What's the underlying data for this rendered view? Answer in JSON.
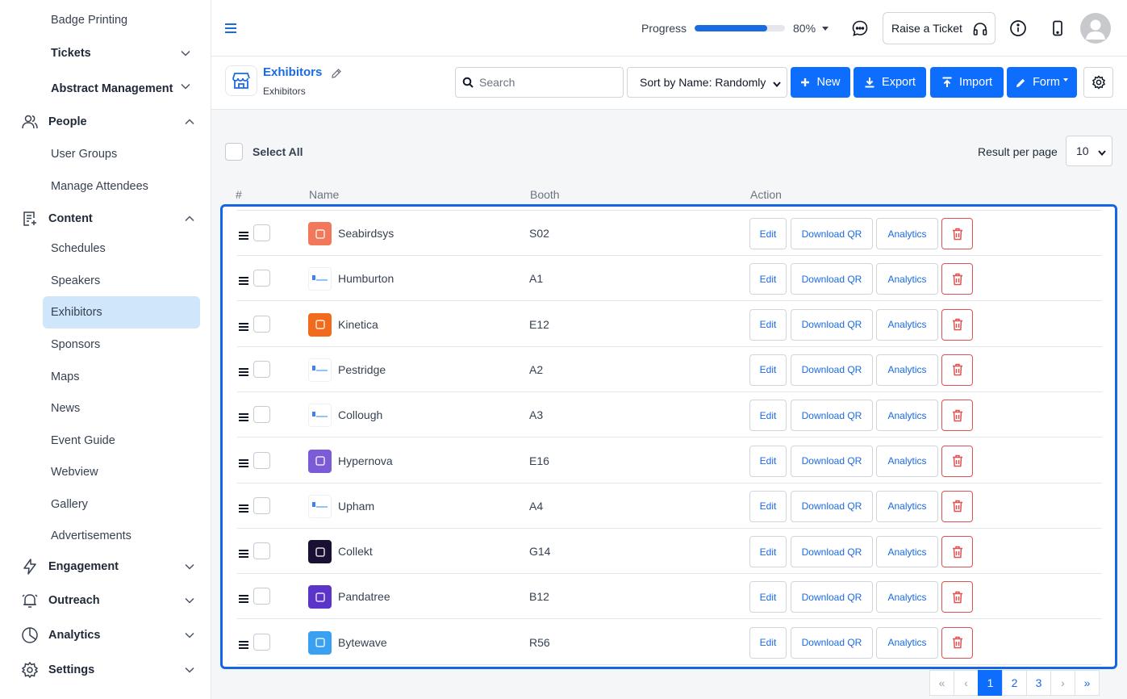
{
  "sidebar": {
    "badge_printing": "Badge Printing",
    "tickets": "Tickets",
    "abstract_management": "Abstract Management",
    "people": "People",
    "user_groups": "User Groups",
    "manage_attendees": "Manage Attendees",
    "content": "Content",
    "schedules": "Schedules",
    "speakers": "Speakers",
    "exhibitors": "Exhibitors",
    "sponsors": "Sponsors",
    "maps": "Maps",
    "news": "News",
    "event_guide": "Event Guide",
    "webview": "Webview",
    "gallery": "Gallery",
    "advertisements": "Advertisements",
    "engagement": "Engagement",
    "outreach": "Outreach",
    "analytics": "Analytics",
    "settings": "Settings",
    "active_item": "Exhibitors"
  },
  "topbar": {
    "progress_label": "Progress",
    "progress_value": 0.8,
    "progress_text": "80%",
    "raise_ticket": "Raise a Ticket",
    "icons": [
      "menu-icon",
      "chat-icon",
      "headset-icon",
      "info-icon",
      "mobile-icon",
      "avatar-icon"
    ]
  },
  "page": {
    "title": "Exhibitors",
    "subtitle": "Exhibitors",
    "search_placeholder": "Search",
    "sort_value": "Sort by Name: Randomly",
    "new_label": "New",
    "export_label": "Export",
    "import_label": "Import",
    "form_label": "Form"
  },
  "list": {
    "select_all": "Select All",
    "result_per_page_label": "Result per page",
    "result_per_page": "10",
    "col_num": "#",
    "col_name": "Name",
    "col_booth": "Booth",
    "col_action": "Action",
    "edit_label": "Edit",
    "qr_label": "Download QR",
    "analytics_label": "Analytics",
    "rows": [
      {
        "name": "Seabirdsys",
        "booth": "S02",
        "logo_color": "#f2785c"
      },
      {
        "name": "Humburton",
        "booth": "A1",
        "logo_color": "#ffffff"
      },
      {
        "name": "Kinetica",
        "booth": "E12",
        "logo_color": "#f26a1b"
      },
      {
        "name": "Pestridge",
        "booth": "A2",
        "logo_color": "#ffffff"
      },
      {
        "name": "Collough",
        "booth": "A3",
        "logo_color": "#ffffff"
      },
      {
        "name": "Hypernova",
        "booth": "E16",
        "logo_color": "#7b5cd6"
      },
      {
        "name": "Upham",
        "booth": "A4",
        "logo_color": "#ffffff"
      },
      {
        "name": "Collekt",
        "booth": "G14",
        "logo_color": "#1a1033"
      },
      {
        "name": "Pandatree",
        "booth": "B12",
        "logo_color": "#5b35c9"
      },
      {
        "name": "Bytewave",
        "booth": "R56",
        "logo_color": "#3aa0f2"
      }
    ]
  },
  "pagination": {
    "first": "«",
    "prev": "‹",
    "pages": [
      "1",
      "2",
      "3"
    ],
    "current": "1",
    "next": "›",
    "last": "»"
  },
  "colors": {
    "accent": "#0d6efd",
    "link": "#1a6be0",
    "active_bg": "#cfe6fb",
    "danger": "#e05252",
    "frame": "#1565e6"
  }
}
